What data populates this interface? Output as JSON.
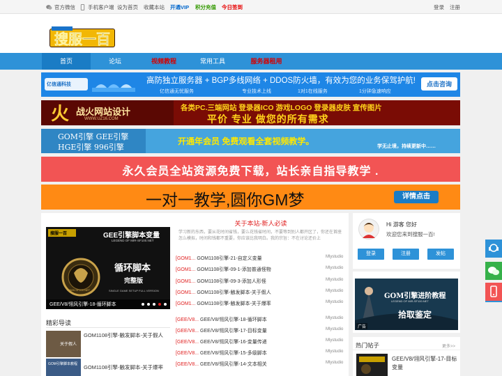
{
  "topbar": {
    "wechat": "官方微信",
    "mobile": "手机客户端",
    "homepage": "设为首页",
    "bookmark": "收藏本站",
    "vip": "开通VIP",
    "recharge": "积分充值",
    "signin": "今日签到",
    "login": "登录",
    "register": "注册"
  },
  "logo": {
    "text": "搜服一百"
  },
  "nav": {
    "items": [
      "首页",
      "论坛",
      "视频教程",
      "常用工具",
      "服务器租用"
    ]
  },
  "banners": {
    "b1": {
      "brand": "亿信通科技",
      "headline": "高防独立服务器 + BGP多线网络 + DDOS防火墙，有效为您的业务保驾护航!",
      "features": [
        "亿信通无忧服务",
        "专业技术上线",
        "1对1在线服务",
        "1分钟急速响应"
      ],
      "cta": "点击咨询"
    },
    "b2": {
      "brand": "战火网站设计",
      "url": "WWW.UZ16.COM",
      "line1": "各类PC.三端网站 登录器ICO 游戏LOGO 登录器皮肤 宣传图片",
      "line2": "平价 专业 做您的所有需求"
    },
    "b3": {
      "left1": "GOM引擎  GEE引擎",
      "left2": "HGE引擎  996引擎",
      "main": "开通年会员 免费观看全套视频教学。",
      "tail": "学无止境，持续更新中……"
    },
    "b4": {
      "text": "永久会员全站资源免费下载，站长亲自指导教学 ."
    },
    "b5": {
      "text": "一对一教学,圆你GM梦",
      "cta": "详情点击"
    }
  },
  "slider": {
    "logo": "搜服一百",
    "title": "GEE引擎脚本变量",
    "subtitle": "LEGEND OF MIR-SF100.NET",
    "tag1": "循环脚本",
    "tag2": "完整版",
    "foot": "SINGLE GAME SETUP FULL VERSION",
    "site": "WWW.SF100.NET",
    "caption": "GEE/V8/翎风引擎-18-循环脚本"
  },
  "notice": {
    "title": "关于本站-新人必读",
    "text": "学习新的东西，要从花时间省钱，要么花钱省时间，不要等到别人都开区了，你还在首座怎么模拟，时间和钱都不重要，你应该比我明白。我的宗旨：不在讨论还价上"
  },
  "list1": [
    {
      "tag": "[GOM1...",
      "title": "GOM1108引擎-21-自定义变量",
      "author": "Mlystudio"
    },
    {
      "tag": "[GOM1...",
      "title": "GOM1108引擎-09-1-添加普通怪物",
      "author": "Mlystudio"
    },
    {
      "tag": "[GOM1...",
      "title": "GOM1108引擎-09-3-添加人形怪",
      "author": "Mlystudio"
    },
    {
      "tag": "[GOM1...",
      "title": "GOM1108引擎-触发脚本-关于假人",
      "author": "Mlystudio"
    },
    {
      "tag": "[GOM1...",
      "title": "GOM1108引擎-触发脚本-关于爆率",
      "author": "Mlystudio"
    }
  ],
  "list2": [
    {
      "tag": "[GEE/V8...",
      "title": "GEE/V8/翎风引擎-18-循环脚本",
      "author": "Mlystudio"
    },
    {
      "tag": "[GEE/V8...",
      "title": "GEE/V8/翎风引擎-17-目标变量",
      "author": "Mlystudio"
    },
    {
      "tag": "[GEE/V8...",
      "title": "GEE/V8/翎风引擎-16-变量传递",
      "author": "Mlystudio"
    },
    {
      "tag": "[GEE/V8...",
      "title": "GEE/V8/翎风引擎-15-多级脚本",
      "author": "Mlystudio"
    },
    {
      "tag": "[GEE/V8...",
      "title": "GEE/V8/翎风引擎-14-文本相关",
      "author": "Mlystudio"
    }
  ],
  "featured": {
    "title": "精彩导读",
    "items": [
      {
        "title": "GOM1108引擎-触发脚本-关于假人",
        "thumb": "关于假人"
      },
      {
        "title": "GOM1108引擎-触发脚本-关于爆率",
        "thumb": "GOM引擎脚本教程"
      }
    ]
  },
  "user": {
    "greeting": "Hi 游客 您好",
    "welcome": "欢迎您来到搜服一百!",
    "login": "登录",
    "register": "注册",
    "post": "发帖"
  },
  "ad_side": {
    "title": "GOM引擎进阶教程",
    "subtitle": "LEGEND OF MIR-SF100.NET",
    "badge": "拾取鉴定",
    "tag": "广告"
  },
  "hot": {
    "title": "热门帖子",
    "more": "更多>>",
    "items": [
      {
        "title": "GEE/V8/翎风引擎-17-目标变量"
      }
    ]
  },
  "float": {
    "icons": [
      "headset-icon",
      "wechat-icon",
      "qq-icon",
      "phone-icon"
    ]
  }
}
